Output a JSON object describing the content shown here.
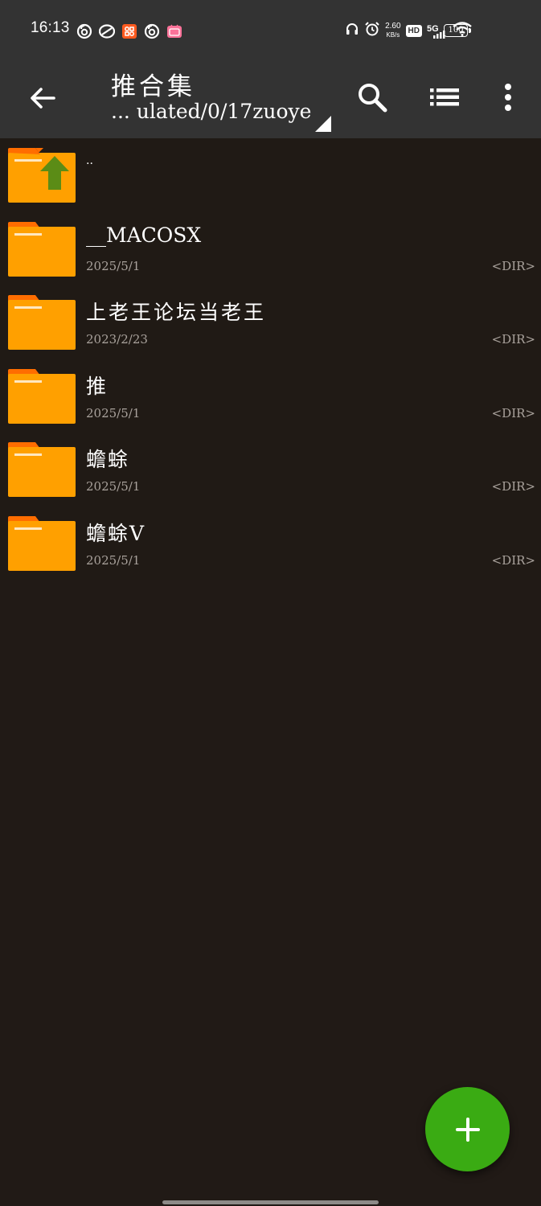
{
  "status_bar": {
    "time": "16:13",
    "net_speed_value": "2.60",
    "net_speed_unit": "KB/s",
    "hd_label": "HD",
    "network_label": "5G",
    "battery_level": "100",
    "app_icons": [
      "netease-music-icon",
      "app-icon",
      "taobao-icon",
      "netease-music-icon",
      "bilibili-icon"
    ],
    "right_icons": [
      "headphones-icon",
      "alarm-icon",
      "hd-icon",
      "signal-icon",
      "wifi-icon",
      "battery-icon"
    ]
  },
  "toolbar": {
    "title": "推合集",
    "path": "... ulated/0/17zuoye",
    "back_icon": "back-arrow-icon",
    "search_icon": "search-icon",
    "view_icon": "list-view-icon",
    "more_icon": "more-vert-icon"
  },
  "files": [
    {
      "name": "..",
      "date": "",
      "type": "",
      "icon": "folder-up-icon"
    },
    {
      "name": "__MACOSX",
      "date": "2025/5/1",
      "type": "<DIR>",
      "icon": "folder-icon"
    },
    {
      "name": "上老王论坛当老王",
      "date": "2023/2/23",
      "type": "<DIR>",
      "icon": "folder-icon"
    },
    {
      "name": "推",
      "date": "2025/5/1",
      "type": "<DIR>",
      "icon": "folder-icon"
    },
    {
      "name": "蟾蜍",
      "date": "2025/5/1",
      "type": "<DIR>",
      "icon": "folder-icon"
    },
    {
      "name": "蟾蜍V",
      "date": "2025/5/1",
      "type": "<DIR>",
      "icon": "folder-icon"
    }
  ],
  "fab": {
    "icon": "plus-icon"
  },
  "colors": {
    "background": "#211a16",
    "toolbar": "#333333",
    "folder": "#ffa000",
    "folder_tab_stripe": "#ff6d00",
    "up_arrow": "#5b8c16",
    "fab": "#3aab13",
    "secondary_text": "#a9a29c"
  }
}
